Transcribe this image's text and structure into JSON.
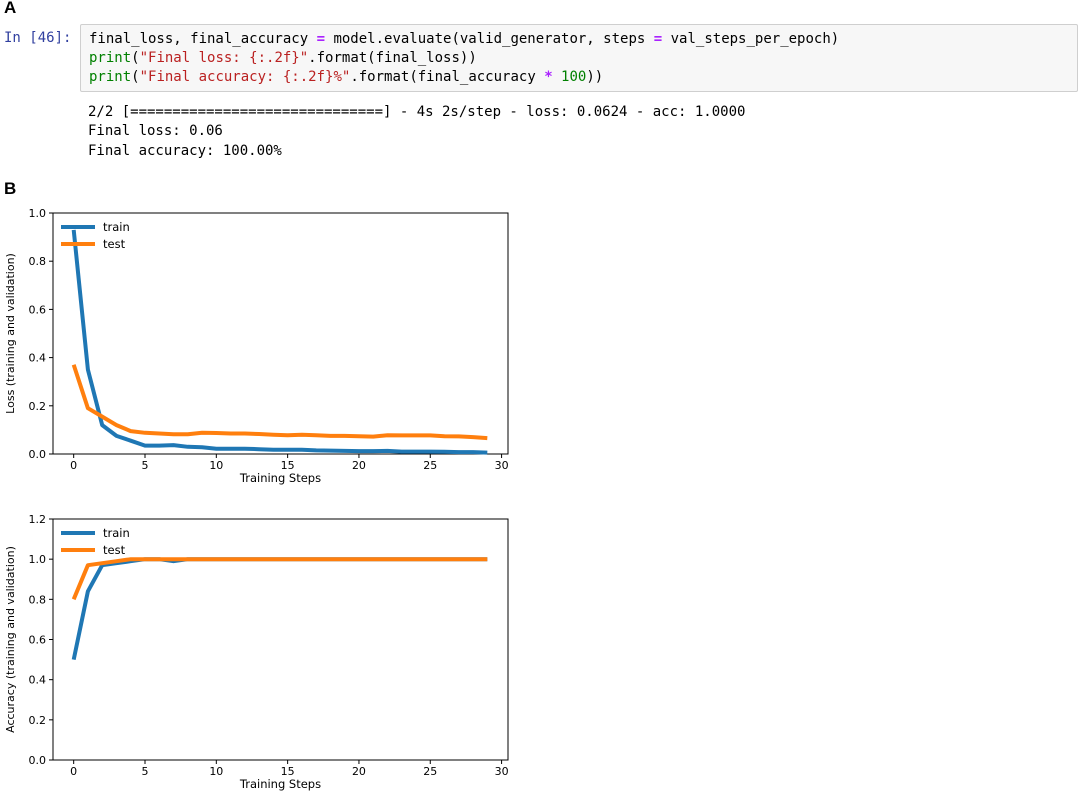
{
  "panels": {
    "a": "A",
    "b": "B"
  },
  "cell": {
    "prompt": "In [46]:",
    "code": {
      "line1": {
        "t1": "final_loss, final_accuracy ",
        "op": "=",
        "t2": " model.evaluate(valid_generator, steps ",
        "op2": "=",
        "t3": " val_steps_per_epoch)"
      },
      "line2": {
        "fn": "print",
        "t1": "(",
        "str": "\"Final loss: {:.2f}\"",
        "t2": ".format(final_loss))"
      },
      "line3": {
        "fn": "print",
        "t1": "(",
        "str": "\"Final accuracy: {:.2f}%\"",
        "t2": ".format(final_accuracy ",
        "op": "*",
        "num": " 100",
        "t3": "))"
      }
    },
    "output": [
      "2/2 [==============================] - 4s 2s/step - loss: 0.0624 - acc: 1.0000",
      "Final loss: 0.06",
      "Final accuracy: 100.00%"
    ]
  },
  "colors": {
    "train": "#1f77b4",
    "test": "#ff7f0e"
  },
  "chart_data": [
    {
      "type": "line",
      "xlabel": "Training Steps",
      "ylabel": "Loss (training and validation)",
      "xlim": [
        -1.45,
        30.45
      ],
      "ylim": [
        0,
        1.0
      ],
      "xticks": [
        0,
        5,
        10,
        15,
        20,
        25,
        30
      ],
      "yticks": [
        0.0,
        0.2,
        0.4,
        0.6,
        0.8,
        1.0
      ],
      "ytick_labels": [
        "0.0",
        "0.2",
        "0.4",
        "0.6",
        "0.8",
        "1.0"
      ],
      "grid": false,
      "legend": "top-left",
      "x": [
        0,
        1,
        2,
        3,
        4,
        5,
        6,
        7,
        8,
        9,
        10,
        11,
        12,
        13,
        14,
        15,
        16,
        17,
        18,
        19,
        20,
        21,
        22,
        23,
        24,
        25,
        26,
        27,
        28,
        29
      ],
      "series": [
        {
          "name": "train",
          "values": [
            0.93,
            0.35,
            0.12,
            0.075,
            0.055,
            0.035,
            0.035,
            0.037,
            0.03,
            0.028,
            0.022,
            0.022,
            0.022,
            0.02,
            0.018,
            0.018,
            0.018,
            0.015,
            0.014,
            0.013,
            0.012,
            0.012,
            0.013,
            0.01,
            0.01,
            0.01,
            0.009,
            0.008,
            0.008,
            0.006
          ]
        },
        {
          "name": "test",
          "values": [
            0.37,
            0.19,
            0.155,
            0.12,
            0.095,
            0.088,
            0.085,
            0.082,
            0.082,
            0.088,
            0.087,
            0.085,
            0.085,
            0.083,
            0.08,
            0.078,
            0.08,
            0.078,
            0.075,
            0.075,
            0.074,
            0.072,
            0.078,
            0.077,
            0.077,
            0.077,
            0.074,
            0.073,
            0.07,
            0.066
          ]
        }
      ]
    },
    {
      "type": "line",
      "xlabel": "Training Steps",
      "ylabel": "Accuracy (training and validation)",
      "xlim": [
        -1.45,
        30.45
      ],
      "ylim": [
        0,
        1.2
      ],
      "xticks": [
        0,
        5,
        10,
        15,
        20,
        25,
        30
      ],
      "yticks": [
        0.0,
        0.2,
        0.4,
        0.6,
        0.8,
        1.0,
        1.2
      ],
      "ytick_labels": [
        "0.0",
        "0.2",
        "0.4",
        "0.6",
        "0.8",
        "1.0",
        "1.2"
      ],
      "grid": false,
      "legend": "top-left",
      "x": [
        0,
        1,
        2,
        3,
        4,
        5,
        6,
        7,
        8,
        9,
        10,
        11,
        12,
        13,
        14,
        15,
        16,
        17,
        18,
        19,
        20,
        21,
        22,
        23,
        24,
        25,
        26,
        27,
        28,
        29
      ],
      "series": [
        {
          "name": "train",
          "values": [
            0.5,
            0.84,
            0.97,
            0.98,
            0.99,
            1.0,
            1.0,
            0.99,
            1.0,
            1.0,
            1.0,
            1.0,
            1.0,
            1.0,
            1.0,
            1.0,
            1.0,
            1.0,
            1.0,
            1.0,
            1.0,
            1.0,
            1.0,
            1.0,
            1.0,
            1.0,
            1.0,
            1.0,
            1.0,
            1.0
          ]
        },
        {
          "name": "test",
          "values": [
            0.8,
            0.97,
            0.98,
            0.99,
            1.0,
            1.0,
            1.0,
            1.0,
            1.0,
            1.0,
            1.0,
            1.0,
            1.0,
            1.0,
            1.0,
            1.0,
            1.0,
            1.0,
            1.0,
            1.0,
            1.0,
            1.0,
            1.0,
            1.0,
            1.0,
            1.0,
            1.0,
            1.0,
            1.0,
            1.0
          ]
        }
      ]
    }
  ]
}
